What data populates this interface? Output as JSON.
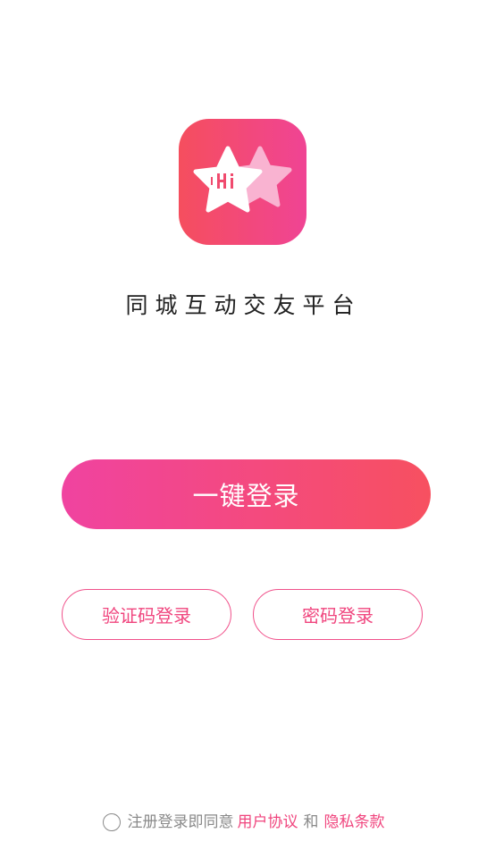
{
  "app": {
    "logo_text": "Hi",
    "tagline": "同城互动交友平台"
  },
  "actions": {
    "one_click_login": "一键登录",
    "sms_login": "验证码登录",
    "password_login": "密码登录"
  },
  "agreement": {
    "prefix": "注册登录即同意",
    "user_agreement": "用户协议",
    "conjunction": "和",
    "privacy_policy": "隐私条款",
    "checked": false
  },
  "colors": {
    "brand_red": "#f54e5e",
    "brand_pink": "#f04494",
    "link": "#f0457e"
  }
}
